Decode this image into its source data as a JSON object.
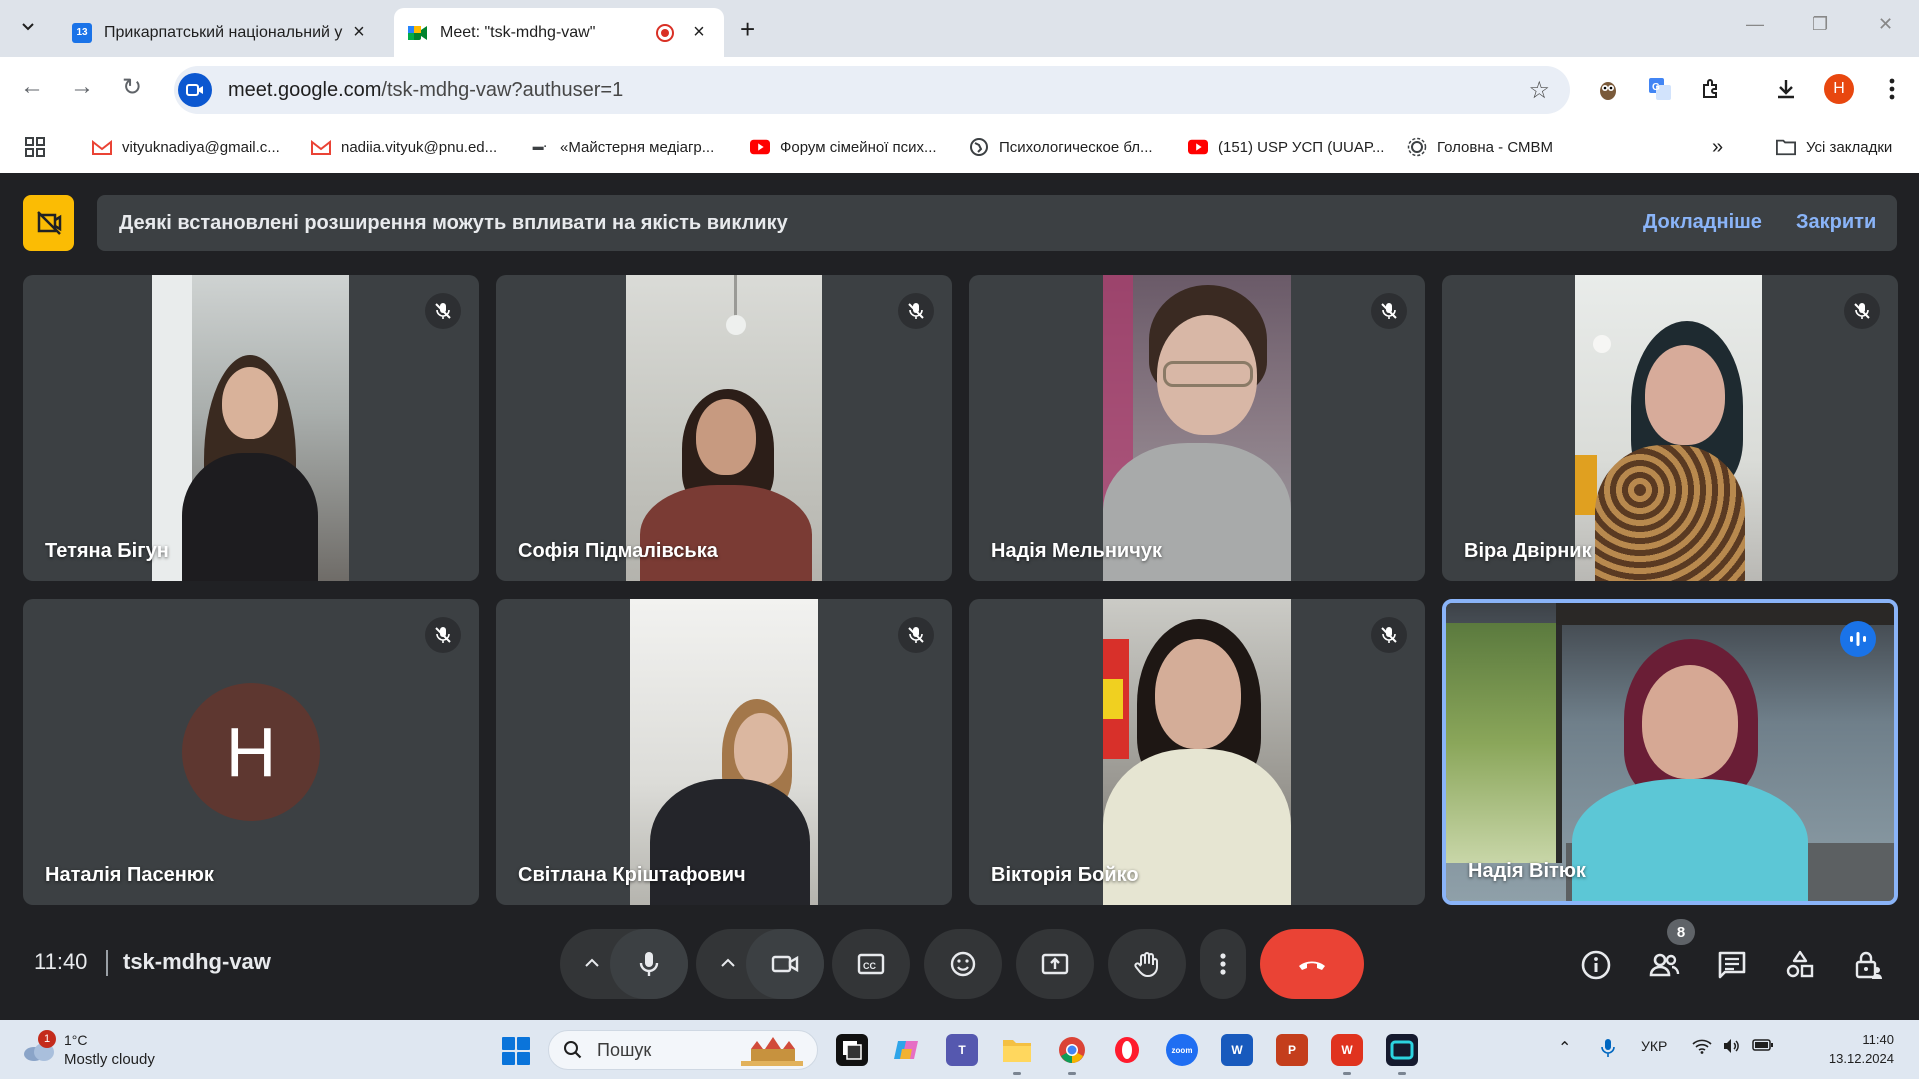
{
  "browser": {
    "tabs": [
      {
        "title": "Прикарпатський національний у",
        "favicon_text": "13",
        "favicon_color": "#1a73e8",
        "active": false
      },
      {
        "title": "Meet: \"tsk-mdhg-vaw\"",
        "active": true
      }
    ],
    "url": {
      "host": "meet.google.com",
      "path": "/tsk-mdhg-vaw?authuser=1"
    },
    "profile_initial": "Н",
    "bookmarks": [
      {
        "label": "vityuknadiya@gmail.c...",
        "icon": "gmail-icon"
      },
      {
        "label": "nadiia.vityuk@pnu.ed...",
        "icon": "gmail-icon"
      },
      {
        "label": "«Майстерня медіагр...",
        "icon": "site-icon"
      },
      {
        "label": "Форум сімейної псих...",
        "icon": "youtube-icon"
      },
      {
        "label": "Психологическое бл...",
        "icon": "globe-icon"
      },
      {
        "label": "(151) USP УСП (UUAP...",
        "icon": "youtube-icon"
      },
      {
        "label": "Головна - СМВМ",
        "icon": "gear-icon"
      }
    ],
    "all_bookmarks_label": "Усі закладки",
    "overflow_label": "»"
  },
  "meet": {
    "notice": {
      "text": "Деякі встановлені розширення можуть впливати на якість виклику",
      "learn_more": "Докладніше",
      "close": "Закрити"
    },
    "participants": [
      {
        "name": "Тетяна Бігун",
        "muted": true
      },
      {
        "name": "Софія Підмалівська",
        "muted": true
      },
      {
        "name": "Надія Мельничук",
        "muted": true
      },
      {
        "name": "Віра Двірник",
        "muted": true
      },
      {
        "name": "Наталія Пасенюк",
        "muted": true,
        "avatar_initial": "Н",
        "avatar_color": "#5e3730"
      },
      {
        "name": "Світлана Кріштафович",
        "muted": true
      },
      {
        "name": "Вікторія Бойко",
        "muted": true
      },
      {
        "name": "Надія Вітюк",
        "muted": false,
        "speaking": true
      }
    ],
    "time": "11:40",
    "meeting_code": "tsk-mdhg-vaw",
    "people_count": "8",
    "colors": {
      "hangup": "#ea4335",
      "accent": "#8ab4f8",
      "notice_icon": "#fbbc04"
    }
  },
  "taskbar": {
    "weather": {
      "temp": "1°C",
      "condition": "Mostly cloudy",
      "badge": "1"
    },
    "search_label": "Пошук",
    "language": "УКР",
    "clock_time": "11:40",
    "clock_date": "13.12.2024"
  }
}
